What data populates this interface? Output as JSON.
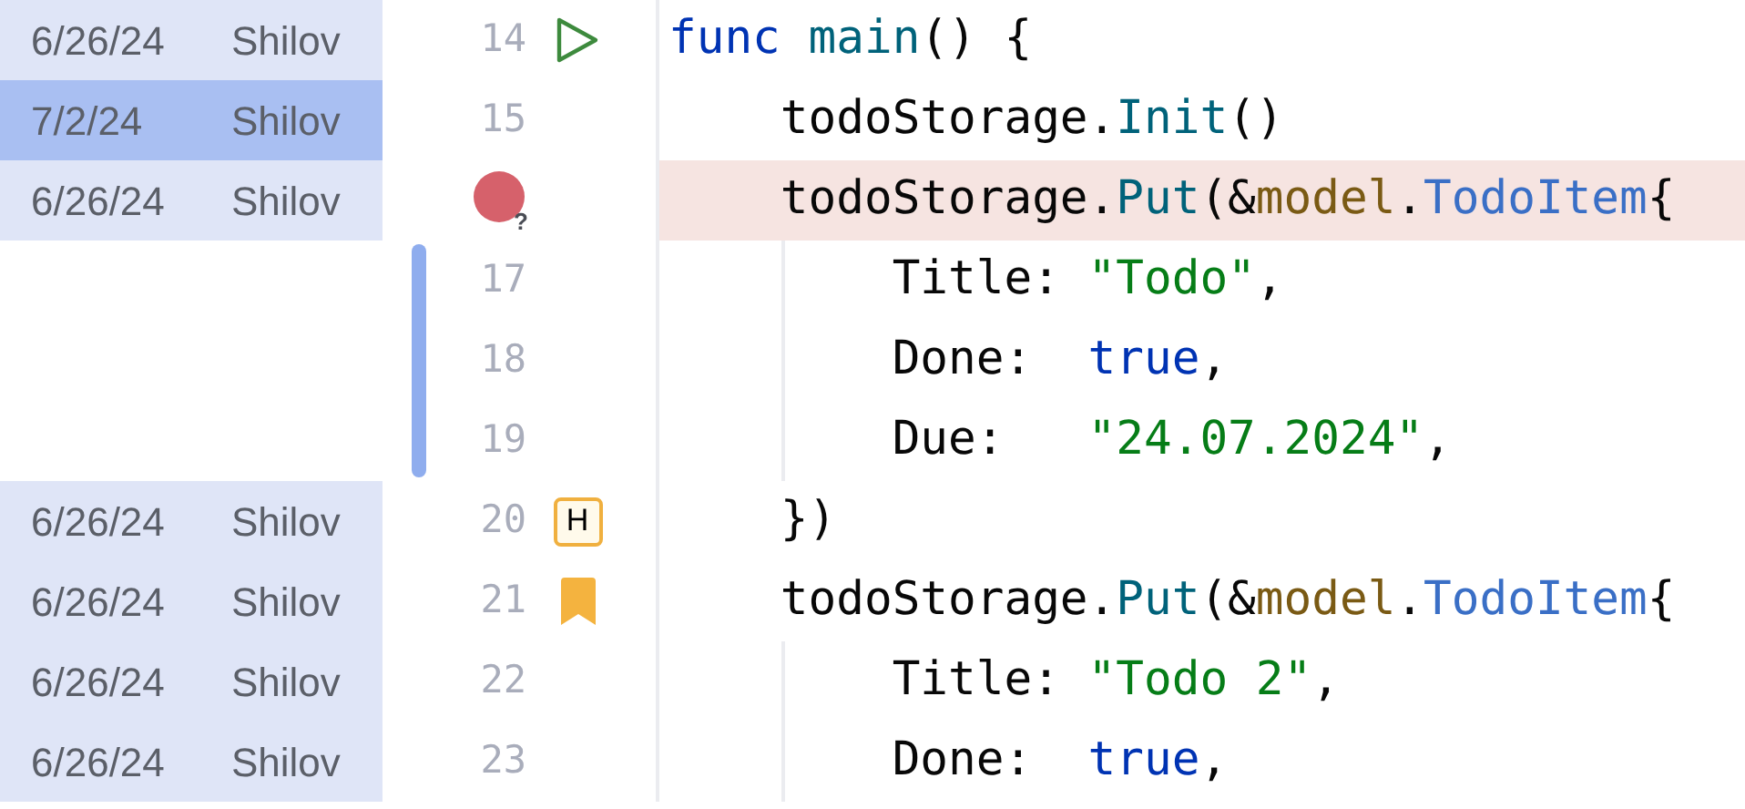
{
  "lines": [
    {
      "number": "14",
      "annotation": {
        "date": "6/26/24",
        "author": "Shilov",
        "selected": false
      },
      "gutter_icon": {
        "kind": "run"
      },
      "changed": false,
      "highlighted": false,
      "tokens": [
        {
          "text": "func ",
          "kind": "keyword"
        },
        {
          "text": "main",
          "kind": "function"
        },
        {
          "text": "() {",
          "kind": "plain"
        }
      ]
    },
    {
      "number": "15",
      "annotation": {
        "date": "7/2/24",
        "author": "Shilov",
        "selected": true
      },
      "changed": false,
      "highlighted": false,
      "tokens": [
        {
          "text": "    todoStorage.",
          "kind": "plain"
        },
        {
          "text": "Init",
          "kind": "function"
        },
        {
          "text": "()",
          "kind": "plain"
        }
      ]
    },
    {
      "annotation": {
        "date": "6/26/24",
        "author": "Shilov",
        "selected": false
      },
      "gutter_icon": {
        "kind": "error",
        "glyph": "?"
      },
      "changed": false,
      "highlighted": true,
      "tokens": [
        {
          "text": "    todoStorage.",
          "kind": "plain"
        },
        {
          "text": "Put",
          "kind": "function"
        },
        {
          "text": "(&",
          "kind": "plain"
        },
        {
          "text": "model",
          "kind": "package"
        },
        {
          "text": ".",
          "kind": "plain"
        },
        {
          "text": "TodoItem",
          "kind": "type"
        },
        {
          "text": "{",
          "kind": "plain"
        }
      ]
    },
    {
      "number": "17",
      "changed": true,
      "highlighted": false,
      "tokens": [
        {
          "text": "        Title: ",
          "kind": "plain"
        },
        {
          "text": "\"Todo\"",
          "kind": "string"
        },
        {
          "text": ",",
          "kind": "plain"
        }
      ]
    },
    {
      "number": "18",
      "changed": true,
      "highlighted": false,
      "tokens": [
        {
          "text": "        Done:  ",
          "kind": "plain"
        },
        {
          "text": "true",
          "kind": "keyword"
        },
        {
          "text": ",",
          "kind": "plain"
        }
      ]
    },
    {
      "number": "19",
      "changed": true,
      "highlighted": false,
      "tokens": [
        {
          "text": "        Due:   ",
          "kind": "plain"
        },
        {
          "text": "\"24.07.2024\"",
          "kind": "string"
        },
        {
          "text": ",",
          "kind": "plain"
        }
      ]
    },
    {
      "number": "20",
      "annotation": {
        "date": "6/26/24",
        "author": "Shilov",
        "selected": false
      },
      "gutter_icon": {
        "kind": "mnemonic",
        "glyph": "H"
      },
      "changed": false,
      "highlighted": false,
      "tokens": [
        {
          "text": "    })",
          "kind": "plain"
        }
      ]
    },
    {
      "number": "21",
      "annotation": {
        "date": "6/26/24",
        "author": "Shilov",
        "selected": false
      },
      "gutter_icon": {
        "kind": "bookmark"
      },
      "changed": false,
      "highlighted": false,
      "tokens": [
        {
          "text": "    todoStorage.",
          "kind": "plain"
        },
        {
          "text": "Put",
          "kind": "function"
        },
        {
          "text": "(&",
          "kind": "plain"
        },
        {
          "text": "model",
          "kind": "package"
        },
        {
          "text": ".",
          "kind": "plain"
        },
        {
          "text": "TodoItem",
          "kind": "type"
        },
        {
          "text": "{",
          "kind": "plain"
        }
      ]
    },
    {
      "number": "22",
      "annotation": {
        "date": "6/26/24",
        "author": "Shilov",
        "selected": false
      },
      "changed": false,
      "highlighted": false,
      "tokens": [
        {
          "text": "        Title: ",
          "kind": "plain"
        },
        {
          "text": "\"Todo 2\"",
          "kind": "string"
        },
        {
          "text": ",",
          "kind": "plain"
        }
      ]
    },
    {
      "number": "23",
      "annotation": {
        "date": "6/26/24",
        "author": "Shilov",
        "selected": false
      },
      "changed": false,
      "highlighted": false,
      "tokens": [
        {
          "text": "        Done:  ",
          "kind": "plain"
        },
        {
          "text": "true",
          "kind": "keyword"
        },
        {
          "text": ",",
          "kind": "plain"
        }
      ]
    }
  ]
}
